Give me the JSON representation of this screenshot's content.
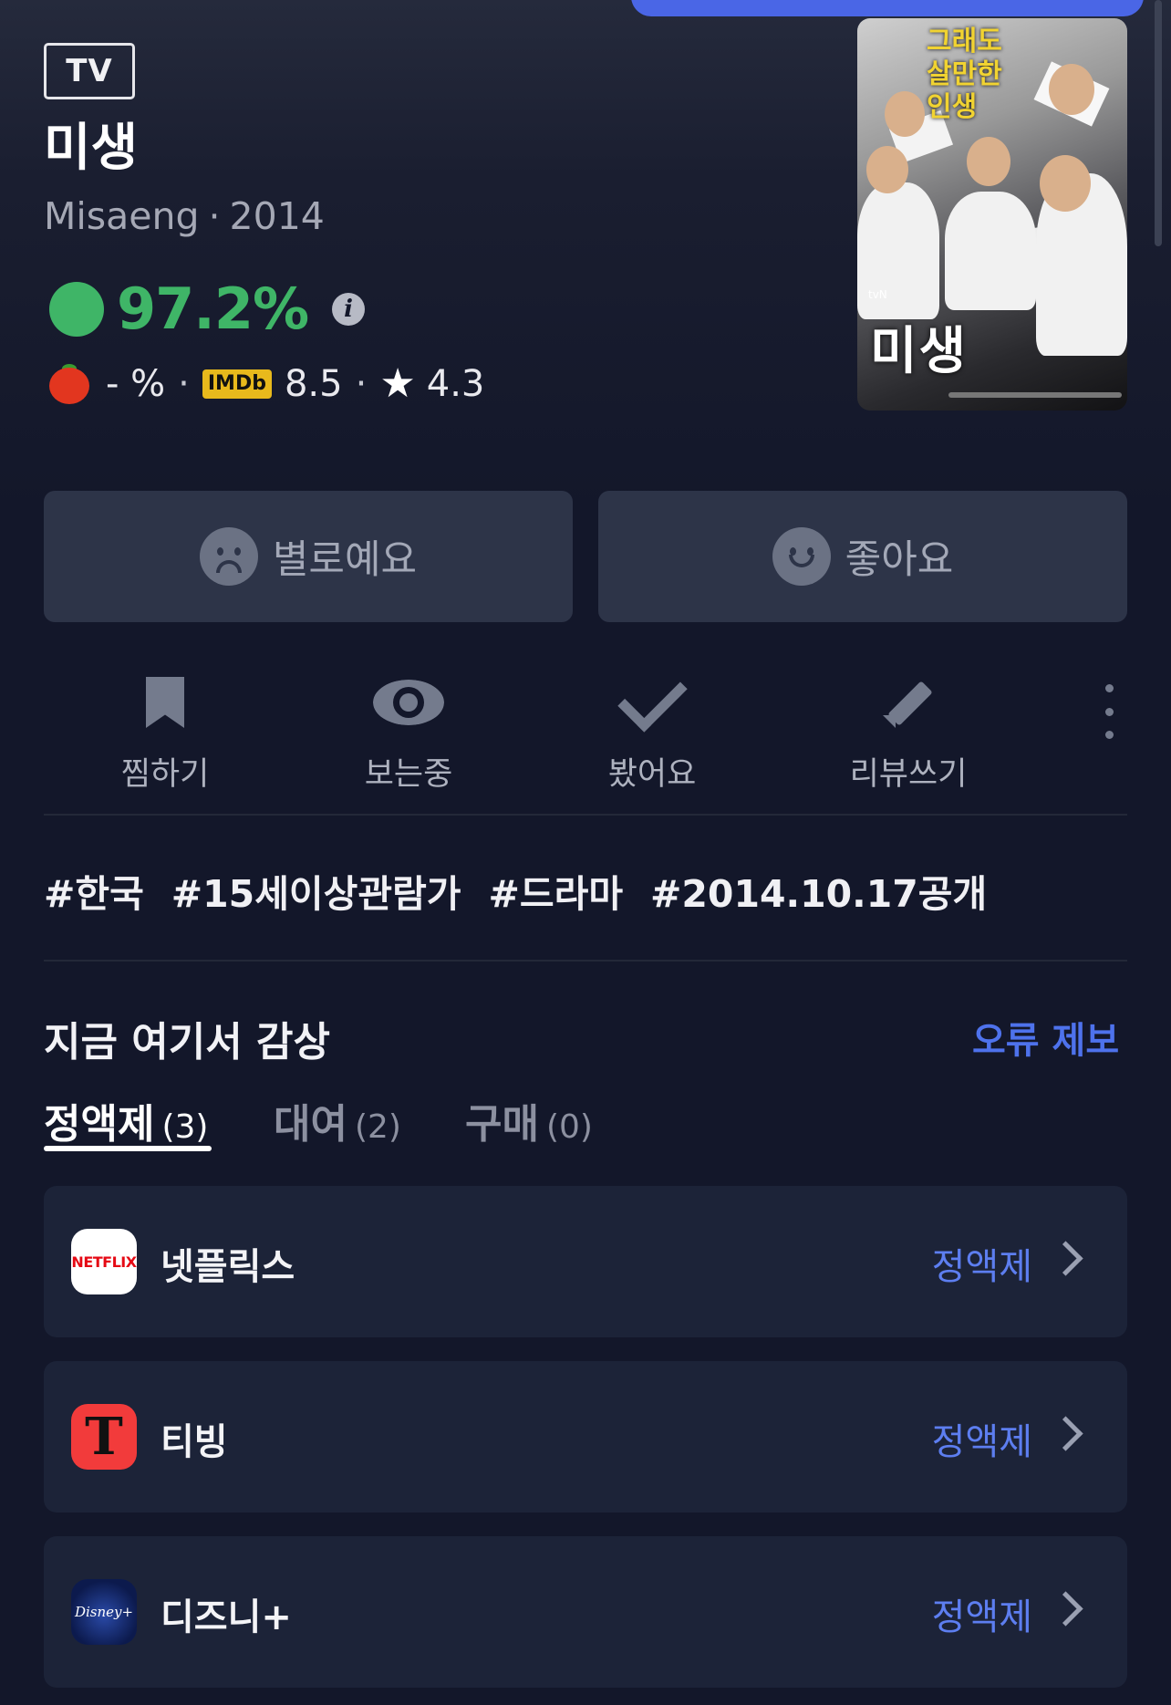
{
  "header": {
    "type_badge": "TV",
    "title": "미생",
    "original_title": "Misaeng",
    "year": "2014"
  },
  "scores": {
    "main_score": "97.2%",
    "main_score_color": "#3fb567",
    "tomato_score": "- %",
    "imdb_badge": "IMDb",
    "imdb_score": "8.5",
    "star_score": "4.3",
    "separator": "·"
  },
  "poster": {
    "tagline": "그래도 살만한 인생",
    "logo_text": "미생",
    "badge": "tvN"
  },
  "reactions": {
    "dislike_label": "별로예요",
    "like_label": "좋아요"
  },
  "actions": {
    "bookmark_label": "찜하기",
    "watching_label": "보는중",
    "watched_label": "봤어요",
    "review_label": "리뷰쓰기"
  },
  "tags": [
    "#한국",
    "#15세이상관람가",
    "#드라마",
    "#2014.10.17공개"
  ],
  "watch_section": {
    "title": "지금 여기서 감상",
    "error_report": "오류 제보",
    "tabs": [
      {
        "label": "정액제",
        "count": "(3)"
      },
      {
        "label": "대여",
        "count": "(2)"
      },
      {
        "label": "구매",
        "count": "(0)"
      }
    ],
    "providers": [
      {
        "name": "넷플릭스",
        "logo_text": "NETFLIX",
        "plan": "정액제"
      },
      {
        "name": "티빙",
        "logo_text": "T",
        "plan": "정액제"
      },
      {
        "name": "디즈니+",
        "logo_text": "Disney+",
        "plan": "정액제"
      }
    ]
  },
  "colors": {
    "accent": "#4e72ec",
    "background": "#13172a",
    "card": "#1c2338"
  }
}
